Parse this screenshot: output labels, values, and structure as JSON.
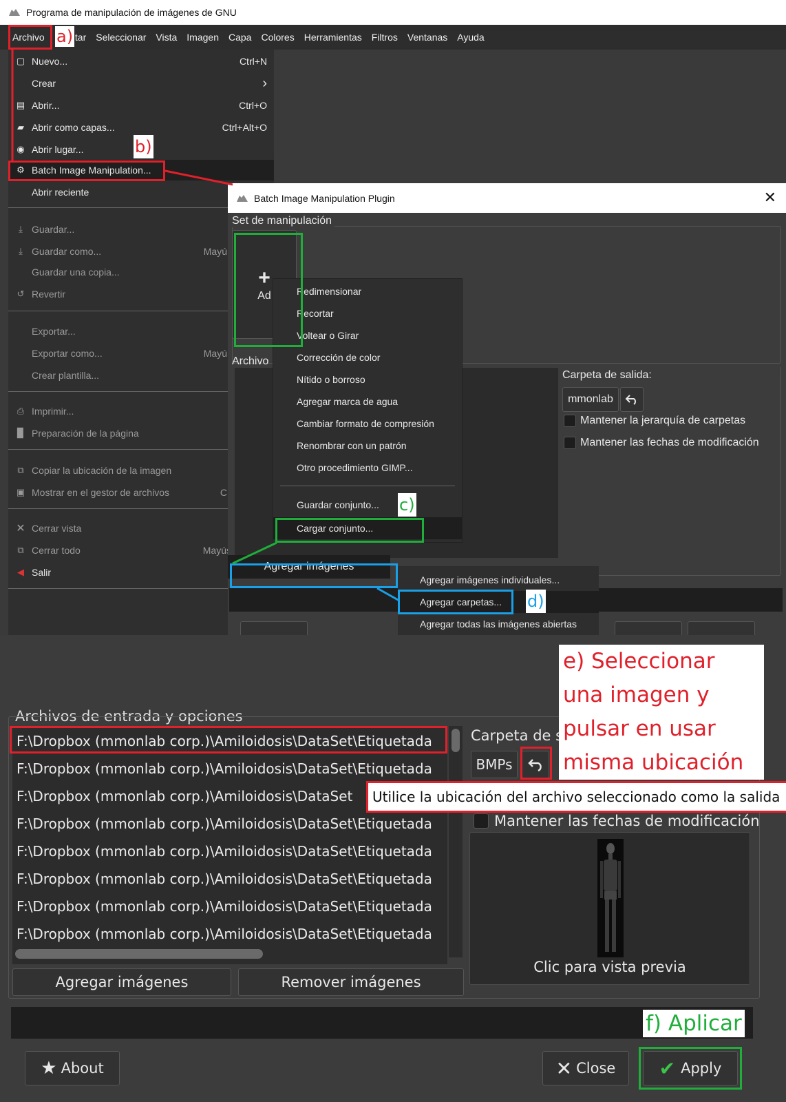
{
  "window": {
    "title": "Programa de manipulación de imágenes de GNU"
  },
  "menubar": {
    "items": [
      "Archivo",
      "Editar",
      "Seleccionar",
      "Vista",
      "Imagen",
      "Capa",
      "Colores",
      "Herramientas",
      "Filtros",
      "Ventanas",
      "Ayuda"
    ]
  },
  "file_menu": {
    "items": [
      {
        "label": "Nuevo...",
        "shortcut": "Ctrl+N",
        "icon": "new-file-icon"
      },
      {
        "label": "Crear",
        "shortcut": "",
        "icon": "",
        "submenu_arrow": "›"
      },
      {
        "label": "Abrir...",
        "shortcut": "Ctrl+O",
        "icon": "open-icon"
      },
      {
        "label": "Abrir como capas...",
        "shortcut": "Ctrl+Alt+O",
        "icon": "open-layers-icon"
      },
      {
        "label": "Abrir lugar...",
        "shortcut": "",
        "icon": "open-location-icon"
      },
      {
        "label": "Batch Image Manipulation...",
        "shortcut": "",
        "icon": "plugin-icon"
      },
      {
        "label": "Abrir reciente",
        "shortcut": "",
        "icon": ""
      },
      {
        "label": "Guardar...",
        "shortcut": "",
        "icon": "save-icon"
      },
      {
        "label": "Guardar como...",
        "shortcut": "Mayú",
        "icon": "save-as-icon"
      },
      {
        "label": "Guardar una copia...",
        "shortcut": "",
        "icon": ""
      },
      {
        "label": "Revertir",
        "shortcut": "",
        "icon": "revert-icon"
      },
      {
        "label": "Exportar...",
        "shortcut": "",
        "icon": ""
      },
      {
        "label": "Exportar como...",
        "shortcut": "Mayú",
        "icon": ""
      },
      {
        "label": "Crear plantilla...",
        "shortcut": "",
        "icon": ""
      },
      {
        "label": "Imprimir...",
        "shortcut": "",
        "icon": "print-icon"
      },
      {
        "label": "Preparación de la página",
        "shortcut": "",
        "icon": "page-setup-icon"
      },
      {
        "label": "Copiar la ubicación de la imagen",
        "shortcut": "",
        "icon": "copy-location-icon"
      },
      {
        "label": "Mostrar en el gestor de archivos",
        "shortcut": "C",
        "icon": "file-manager-icon"
      },
      {
        "label": "Cerrar vista",
        "shortcut": "",
        "icon": "close-view-icon"
      },
      {
        "label": "Cerrar todo",
        "shortcut": "Mayús",
        "icon": "close-all-icon"
      },
      {
        "label": "Salir",
        "shortcut": "",
        "icon": "quit-icon"
      }
    ]
  },
  "dialog": {
    "title": "Batch Image Manipulation Plugin",
    "set_label": "Set de manipulación",
    "add_label": "Ad",
    "files_label": "Archivo",
    "output_folder_label": "Carpeta de salida:",
    "output_folder_value": "mmonlab",
    "keep_hierarchy": "Mantener la jerarquía de carpetas",
    "keep_dates": "Mantener las fechas de modificación",
    "add_images": "Agregar imágenes"
  },
  "context_menu": {
    "items": [
      "Redimensionar",
      "Recortar",
      "Voltear o Girar",
      "Corrección de color",
      "Nítido o borroso",
      "Agregar marca de agua",
      "Cambiar formato de compresión",
      "Renombrar con un patrón",
      "Otro procedimiento GIMP...",
      "Guardar conjunto...",
      "Cargar conjunto..."
    ]
  },
  "add_submenu": {
    "items": [
      "Agregar imágenes individuales...",
      "Agregar carpetas...",
      "Agregar todas las imágenes abiertas"
    ]
  },
  "lower": {
    "section_label": "Archivos de entrada y opciones",
    "files": [
      "F:\\Dropbox (mmonlab corp.)\\Amiloidosis\\DataSet\\Etiquetada",
      "F:\\Dropbox (mmonlab corp.)\\Amiloidosis\\DataSet\\Etiquetada",
      "F:\\Dropbox (mmonlab corp.)\\Amiloidosis\\DataSet",
      "F:\\Dropbox (mmonlab corp.)\\Amiloidosis\\DataSet\\Etiquetada",
      "F:\\Dropbox (mmonlab corp.)\\Amiloidosis\\DataSet\\Etiquetada",
      "F:\\Dropbox (mmonlab corp.)\\Amiloidosis\\DataSet\\Etiquetada",
      "F:\\Dropbox (mmonlab corp.)\\Amiloidosis\\DataSet\\Etiquetada",
      "F:\\Dropbox (mmonlab corp.)\\Amiloidosis\\DataSet\\Etiquetada"
    ],
    "output_label": "Carpeta de s",
    "output_value": "BMPs",
    "tooltip": "Utilice la ubicación del archivo seleccionado como la salida",
    "keep_dates": "Mantener las fechas de modificación",
    "preview_label": "Clic para vista previa",
    "add_button": "Agregar imágenes",
    "remove_button": "Remover imágenes",
    "about_button": "About",
    "close_button": "Close",
    "apply_button": "Apply"
  },
  "annotations": {
    "a": "a)",
    "b": "b)",
    "c": "c)",
    "d": "d)",
    "e_lines": [
      "e) Seleccionar",
      "una imagen y",
      "pulsar en usar",
      "misma ubicación"
    ],
    "f": "f) Aplicar",
    "colors": {
      "red": "#e0202a",
      "green": "#1fae3a",
      "blue": "#1aa0e8"
    }
  }
}
